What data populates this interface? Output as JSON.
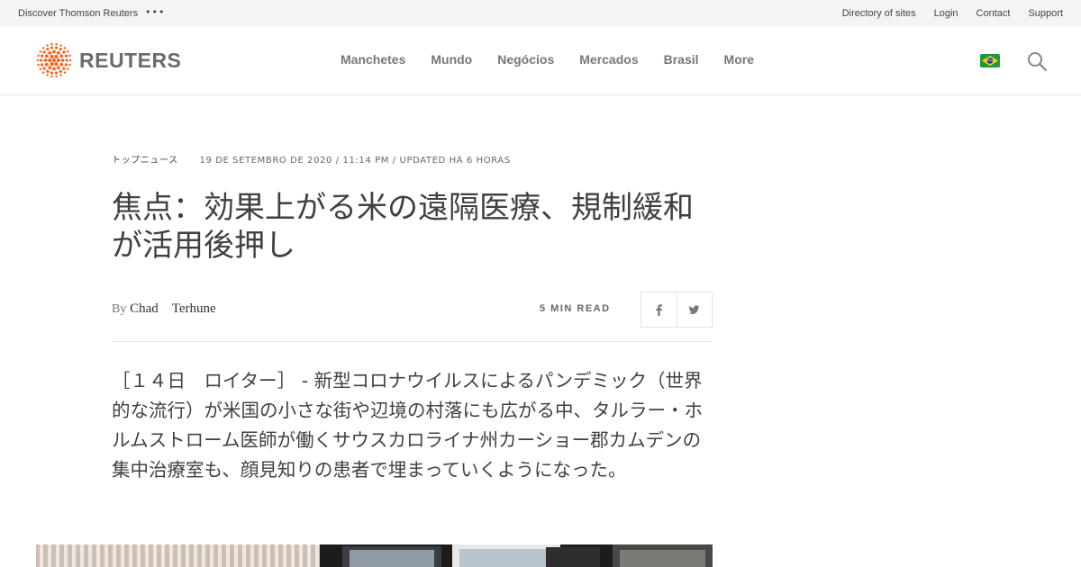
{
  "utility": {
    "discover": "Discover Thomson Reuters",
    "links": [
      "Directory of sites",
      "Login",
      "Contact",
      "Support"
    ]
  },
  "header": {
    "logo_text": "REUTERS",
    "logo_color": "#f26522",
    "nav": [
      "Manchetes",
      "Mundo",
      "Negócios",
      "Mercados",
      "Brasil",
      "More"
    ],
    "flag_icon": "brazil-flag-icon",
    "search_icon": "search-icon"
  },
  "article": {
    "section": "トップニュース",
    "dateline": "19 DE SETEMBRO DE 2020 / 11:14 PM / UPDATED HÁ 6 HORAS",
    "title": "焦点：効果上がる米の遠隔医療、規制緩和が活用後押し",
    "byline_prefix": "By",
    "author_first": "Chad",
    "author_last": "Terhune",
    "read_time": "5 MIN READ",
    "share": [
      "facebook-icon",
      "twitter-icon"
    ],
    "body": "［１４日　ロイター］ - 新型コロナウイルスによるパンデミック（世界的な流行）が米国の小さな街や辺境の村落にも広がる中、タルラー・ホルムストローム医師が働くサウスカロライナ州カーショー郡カムデンの集中治療室も、顔見知りの患者で埋まっていくようになった。"
  }
}
